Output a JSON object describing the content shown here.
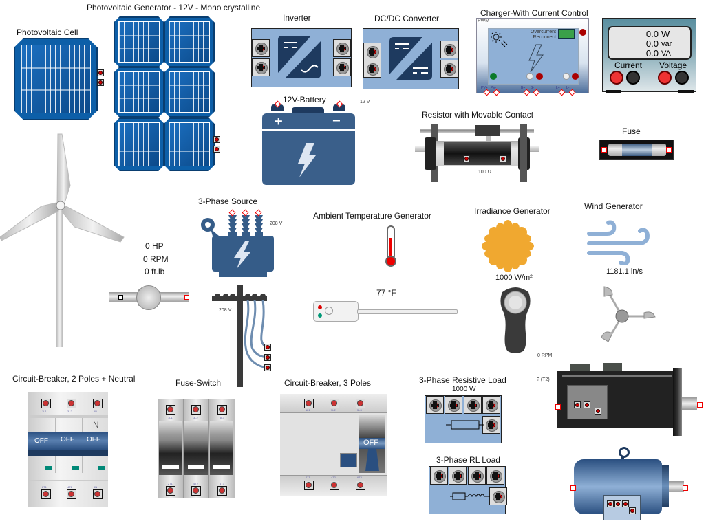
{
  "components": {
    "pv_cell": {
      "label": "Photovoltaic Cell"
    },
    "pv_generator": {
      "label": "Photovoltaic Generator - 12V - Mono crystalline"
    },
    "inverter": {
      "label": "Inverter"
    },
    "dcdc": {
      "label": "DC/DC Converter"
    },
    "charger": {
      "label": "Charger-With Current Control",
      "mode": "PWM",
      "overcurrent": "Overcurrent",
      "reconnect": "Reconnect",
      "terminals": [
        "PV+",
        "PV-",
        "B+",
        "B-",
        "L+",
        "L-"
      ]
    },
    "power_meter": {
      "readings": [
        {
          "value": "0.0",
          "unit": "W"
        },
        {
          "value": "0.0",
          "unit": "var"
        },
        {
          "value": "0.0",
          "unit": "VA"
        }
      ],
      "current_label": "Current",
      "voltage_label": "Voltage"
    },
    "battery": {
      "label": "12V-Battery",
      "voltage": "12 V",
      "plus": "+",
      "minus": "−"
    },
    "resistor": {
      "label": "Resistor with Movable Contact",
      "value": "100 Ω"
    },
    "fuse": {
      "label": "Fuse"
    },
    "wind_turbine": {
      "hp": "0 HP",
      "rpm": "0 RPM",
      "torque": "0 ft.lb"
    },
    "three_phase_source": {
      "label": "3-Phase Source",
      "voltage": "208 V",
      "pole_voltage": "208 V"
    },
    "ambient_temp": {
      "label": "Ambient Temperature Generator",
      "value": "77 °F"
    },
    "irradiance": {
      "label": "Irradiance Generator",
      "value": "1000 W/m²"
    },
    "wind_generator": {
      "label": "Wind Generator",
      "value": "1181.1 in/s"
    },
    "tachometer": {
      "rpm": "0 RPM"
    },
    "breaker_2p_n": {
      "label": "Circuit-Breaker, 2 Poles + Neutral",
      "neutral": "N",
      "switch_state": "OFF",
      "top_terminals": [
        "1L1",
        "3L2",
        "5N"
      ],
      "bottom_terminals": [
        "2T1",
        "4T2",
        "6N"
      ]
    },
    "fuse_switch": {
      "label": "Fuse-Switch",
      "top_terminals": [
        "1L1",
        "3L2",
        "5L3"
      ],
      "bottom_terminals": [
        "2T1",
        "4T2",
        "6T3"
      ]
    },
    "breaker_3p": {
      "label": "Circuit-Breaker, 3 Poles",
      "switch_state": "OFF",
      "top_terminals": [
        "1L1",
        "3L2",
        "5L3"
      ],
      "bottom_terminals": [
        "2T1",
        "4T2",
        "6T3"
      ]
    },
    "resistive_load": {
      "label": "3-Phase Resistive Load",
      "power": "1000 W"
    },
    "rl_load": {
      "label": "3-Phase RL Load"
    },
    "servo_motor": {
      "rpm": "0 RPM",
      "torque": "? (T2)"
    },
    "induction_motor": {}
  }
}
